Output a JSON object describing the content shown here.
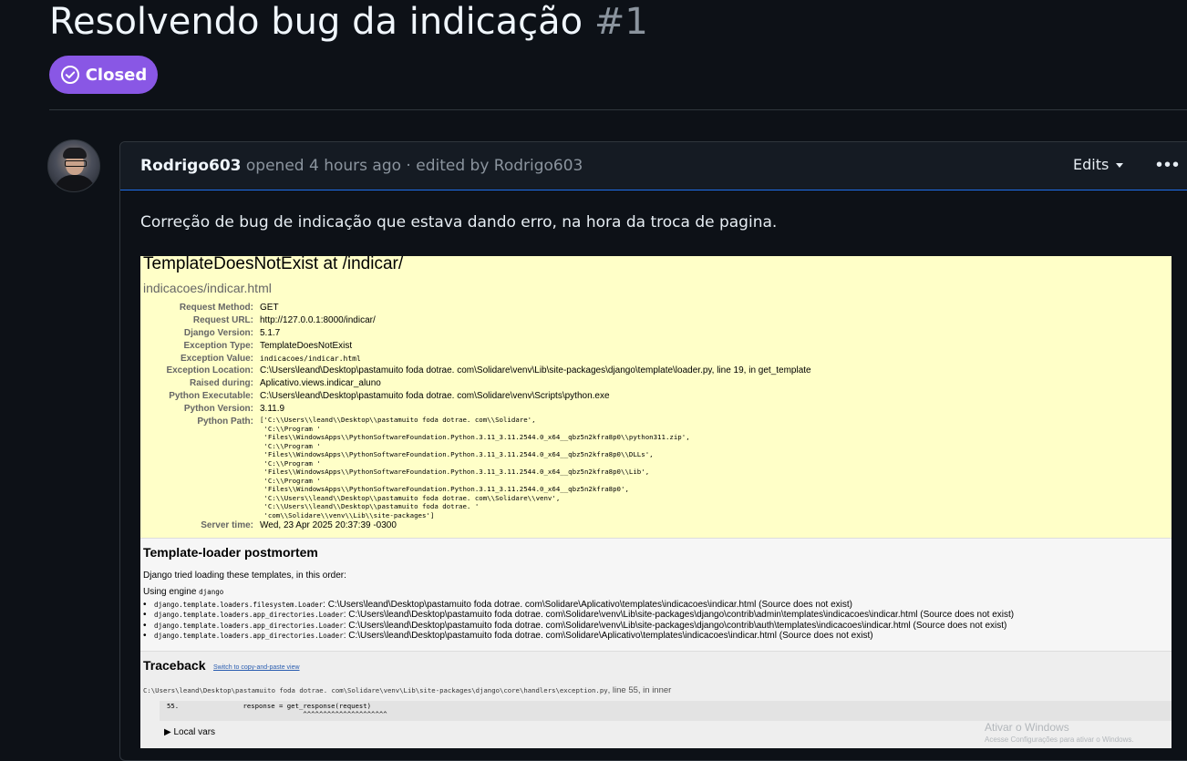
{
  "issue": {
    "title": "Resolvendo bug da indicação",
    "number": "#1",
    "state_label": "Closed"
  },
  "comment": {
    "author": "Rodrigo603",
    "action": "opened",
    "time_ago": "4 hours ago",
    "edited_prefix": "· edited by",
    "editor": "Rodrigo603",
    "edits_label": "Edits",
    "more_label": "•••",
    "body": "Correção de bug de indicação que estava dando erro, na hora da troca de pagina."
  },
  "django": {
    "title": "TemplateDoesNotExist at /indicar/",
    "subtitle": "indicacoes/indicar.html",
    "rows": [
      {
        "key": "Request Method:",
        "value": "GET"
      },
      {
        "key": "Request URL:",
        "value": "http://127.0.0.1:8000/indicar/"
      },
      {
        "key": "Django Version:",
        "value": "5.1.7"
      },
      {
        "key": "Exception Type:",
        "value": "TemplateDoesNotExist"
      },
      {
        "key": "Exception Value:",
        "value": "indicacoes/indicar.html"
      },
      {
        "key": "Exception Location:",
        "value": "C:\\Users\\leand\\Desktop\\pastamuito foda dotrae. com\\Solidare\\venv\\Lib\\site-packages\\django\\template\\loader.py, line 19, in get_template"
      },
      {
        "key": "Raised during:",
        "value": "Aplicativo.views.indicar_aluno"
      },
      {
        "key": "Python Executable:",
        "value": "C:\\Users\\leand\\Desktop\\pastamuito foda dotrae. com\\Solidare\\venv\\Scripts\\python.exe"
      },
      {
        "key": "Python Version:",
        "value": "3.11.9"
      },
      {
        "key": "Python Path:",
        "value": ""
      },
      {
        "key": "Server time:",
        "value": "Wed, 23 Apr 2025 20:37:39 -0300"
      }
    ],
    "python_path": "['C:\\\\Users\\\\leand\\\\Desktop\\\\pastamuito foda dotrae. com\\\\Solidare',\n 'C:\\\\Program '\n 'Files\\\\WindowsApps\\\\PythonSoftwareFoundation.Python.3.11_3.11.2544.0_x64__qbz5n2kfra8p0\\\\python311.zip',\n 'C:\\\\Program '\n 'Files\\\\WindowsApps\\\\PythonSoftwareFoundation.Python.3.11_3.11.2544.0_x64__qbz5n2kfra8p0\\\\DLLs',\n 'C:\\\\Program '\n 'Files\\\\WindowsApps\\\\PythonSoftwareFoundation.Python.3.11_3.11.2544.0_x64__qbz5n2kfra8p0\\\\Lib',\n 'C:\\\\Program '\n 'Files\\\\WindowsApps\\\\PythonSoftwareFoundation.Python.3.11_3.11.2544.0_x64__qbz5n2kfra8p0',\n 'C:\\\\Users\\\\leand\\\\Desktop\\\\pastamuito foda dotrae. com\\\\Solidare\\\\venv',\n 'C:\\\\Users\\\\leand\\\\Desktop\\\\pastamuito foda dotrae. '\n 'com\\\\Solidare\\\\venv\\\\Lib\\\\site-packages']",
    "postmortem": {
      "title": "Template-loader postmortem",
      "intro": "Django tried loading these templates, in this order:",
      "engine_label": "Using engine",
      "engine_name": "django",
      "items": [
        {
          "loader": "django.template.loaders.filesystem.Loader",
          "path": "C:\\Users\\leand\\Desktop\\pastamuito foda dotrae. com\\Solidare\\Aplicativo\\templates\\indicacoes\\indicar.html (Source does not exist)"
        },
        {
          "loader": "django.template.loaders.app_directories.Loader",
          "path": "C:\\Users\\leand\\Desktop\\pastamuito foda dotrae. com\\Solidare\\venv\\Lib\\site-packages\\django\\contrib\\admin\\templates\\indicacoes\\indicar.html (Source does not exist)"
        },
        {
          "loader": "django.template.loaders.app_directories.Loader",
          "path": "C:\\Users\\leand\\Desktop\\pastamuito foda dotrae. com\\Solidare\\venv\\Lib\\site-packages\\django\\contrib\\auth\\templates\\indicacoes\\indicar.html (Source does not exist)"
        },
        {
          "loader": "django.template.loaders.app_directories.Loader",
          "path": "C:\\Users\\leand\\Desktop\\pastamuito foda dotrae. com\\Solidare\\Aplicativo\\templates\\indicacoes\\indicar.html (Source does not exist)"
        }
      ]
    },
    "traceback": {
      "title": "Traceback",
      "switch_link": "Switch to copy-and-paste view",
      "file": "C:\\Users\\leand\\Desktop\\pastamuito foda dotrae. com\\Solidare\\venv\\Lib\\site-packages\\django\\core\\handlers\\exception.py",
      "line_info": ", line 55, in inner",
      "code_line": "55.                response = get_response(request)",
      "code_marker": "                                  ^^^^^^^^^^^^^^^^^^^^^",
      "local_vars": "▶ Local vars"
    }
  },
  "watermark": {
    "line1": "Ativar o Windows",
    "line2": "Acesse Configurações para ativar o Windows."
  },
  "colors": {
    "background": "#0d1117",
    "closed_badge": "#8957e5",
    "django_summary": "#ffffc8"
  }
}
